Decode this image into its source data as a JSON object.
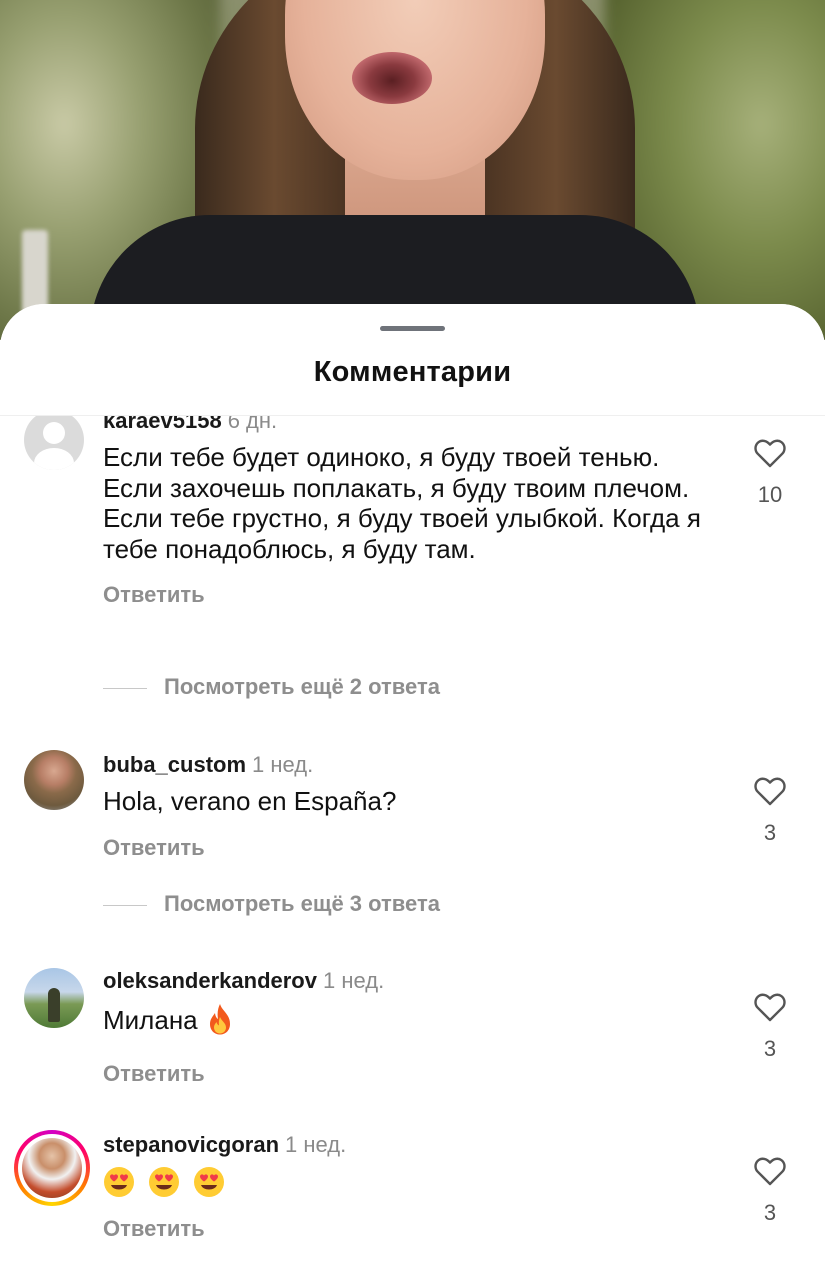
{
  "sheet": {
    "title": "Комментарии"
  },
  "comments": [
    {
      "username": "karaev5158",
      "time": "6 дн.",
      "text": "Если тебе будет одиноко, я буду твоей тенью. Если захочешь поплакать, я буду твоим плечом. Если тебе грустно, я буду твоей улыбкой. Когда я тебе понадоблюсь, я буду там.",
      "reply_label": "Ответить",
      "likes": "10",
      "more_replies": "Посмотреть ещё 2 ответа",
      "avatar": "default-avatar-icon"
    },
    {
      "username": "buba_custom",
      "time": "1 нед.",
      "text": "Hola, verano en España?",
      "reply_label": "Ответить",
      "likes": "3",
      "more_replies": "Посмотреть ещё 3 ответа",
      "avatar": "photo"
    },
    {
      "username": "oleksanderkanderov",
      "time": "1 нед.",
      "text": "Милана",
      "emoji": "fire-emoji",
      "reply_label": "Ответить",
      "likes": "3",
      "avatar": "photo"
    },
    {
      "username": "stepanovicgoran",
      "time": "1 нед.",
      "emoji": "heart-eyes-emoji x3",
      "reply_label": "Ответить",
      "likes": "3",
      "avatar": "photo-with-story-ring"
    }
  ],
  "colors": {
    "text": "#111111",
    "secondary": "#8e8e8e",
    "story_ring": [
      "#d300c5",
      "#ff0069",
      "#ff7a00",
      "#ffd600"
    ]
  }
}
